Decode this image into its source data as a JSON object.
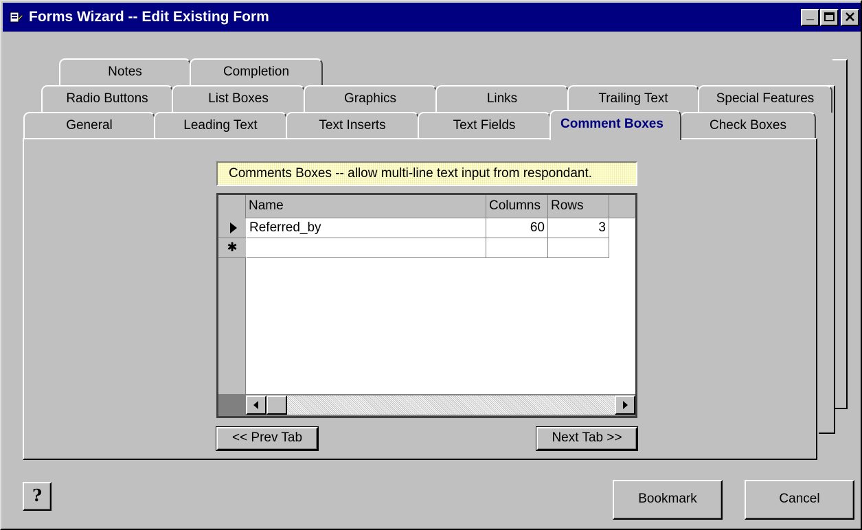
{
  "window": {
    "title": "Forms Wizard -- Edit Existing Form",
    "controls": {
      "minimize": "_",
      "maximize": "□",
      "close": "✕"
    }
  },
  "tabs": {
    "row1": [
      "Notes",
      "Completion"
    ],
    "row2": [
      "Radio Buttons",
      "List Boxes",
      "Graphics",
      "Links",
      "Trailing Text",
      "Special Features"
    ],
    "row3": [
      "General",
      "Leading Text",
      "Text Inserts",
      "Text Fields",
      "Comment Boxes",
      "Check Boxes"
    ],
    "active": "Comment Boxes"
  },
  "panel": {
    "info": "Comments Boxes -- allow multi-line text input from respondant.",
    "grid": {
      "columns": [
        "Name",
        "Columns",
        "Rows"
      ],
      "rows": [
        {
          "name": "Referred_by",
          "columns": "60",
          "rows": "3"
        }
      ],
      "current_row_indicator": "▶",
      "new_row_indicator": "✱"
    },
    "prev_button": "<< Prev Tab",
    "next_button": "Next Tab >>"
  },
  "footer": {
    "help_icon": "?",
    "bookmark_button": "Bookmark",
    "cancel_button": "Cancel"
  },
  "colors": {
    "titlebar": "#000080",
    "face": "#c0c0c0",
    "active_tab_text": "#000080",
    "info_bg": "#ffffd0"
  }
}
